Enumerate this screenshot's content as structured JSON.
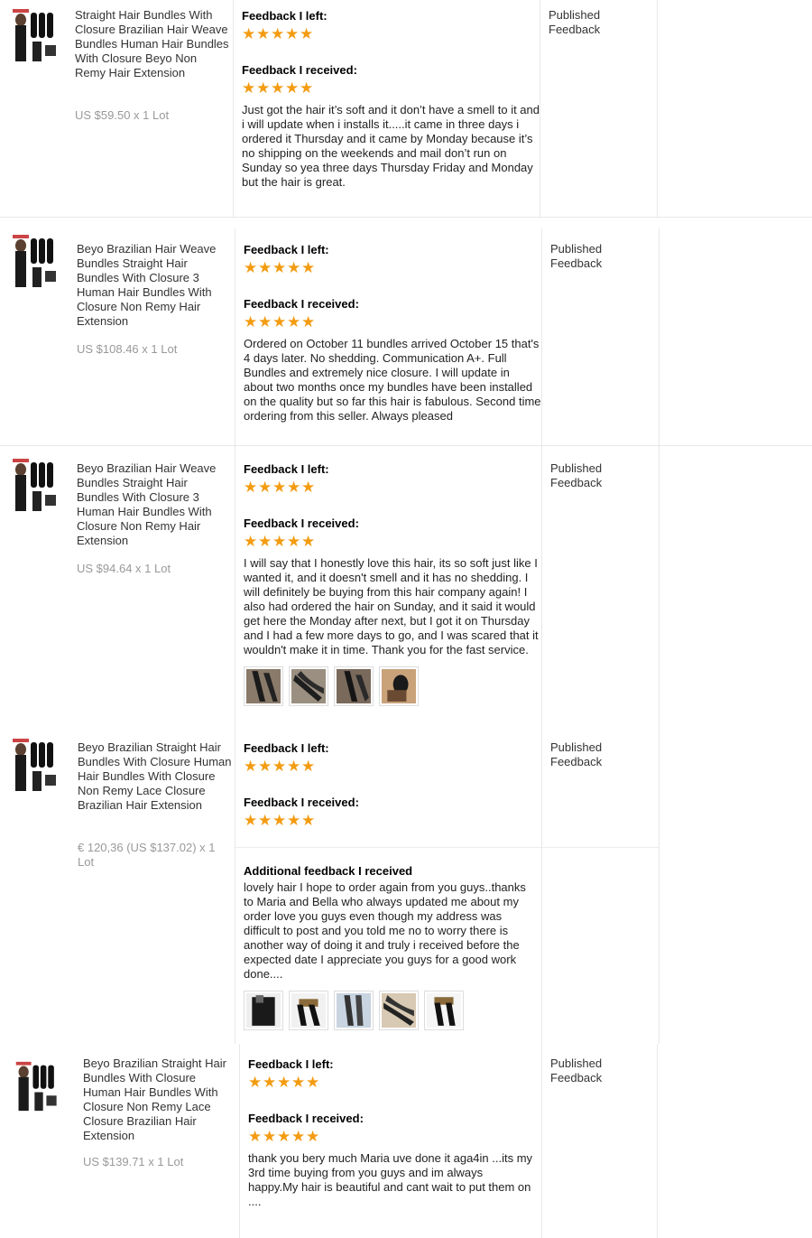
{
  "orders": [
    {
      "title": "Straight Hair Bundles With Closure Brazilian Hair Weave Bundles Human Hair Bundles With Closure Beyo Non Remy Hair Extension",
      "price": "US $59.50 x 1 Lot",
      "left_heading": "Feedback I left:",
      "received_heading": "Feedback I received:",
      "received_text": "Just got the hair it’s soft and it don’t have a smell to it and i will update when i installs it.....it came in three days i ordered it Thursday and it came by Monday because it’s no shipping on the weekends and mail don’t run on Sunday so yea three days Thursday Friday and Monday but the hair is great.",
      "status": "Published Feedback",
      "left_stars": 5,
      "received_stars": 5
    },
    {
      "title": "Beyo Brazilian Hair Weave Bundles Straight Hair Bundles With Closure 3 Human Hair Bundles With Closure Non Remy Hair Extension",
      "price": "US $108.46 x 1 Lot",
      "left_heading": "Feedback I left:",
      "received_heading": "Feedback I received:",
      "received_text": "Ordered on October 11 bundles arrived October 15 that's 4 days later. No shedding. Communication A+. Full Bundles and extremely nice closure. I will update in about two months once my bundles have been installed on the quality but so far this hair is fabulous. Second time ordering from this seller. Always pleased",
      "status": "Published Feedback",
      "left_stars": 5,
      "received_stars": 5
    },
    {
      "title": "Beyo Brazilian Hair Weave Bundles Straight Hair Bundles With Closure 3 Human Hair Bundles With Closure Non Remy Hair Extension",
      "price": "US $94.64 x 1 Lot",
      "left_heading": "Feedback I left:",
      "received_heading": "Feedback I received:",
      "received_text": "I will say that I honestly love this hair, its so soft just like I wanted it, and it doesn't smell and it has no shedding. I will definitely be buying from this hair company again! I also had ordered the hair on Sunday, and it said it would get here the Monday after next, but I got it on Thursday and I had a few more days to go, and I was scared that it wouldn't make it in time. Thank you for the fast service.",
      "status": "Published Feedback",
      "left_stars": 5,
      "received_stars": 5,
      "photo_count": 4
    },
    {
      "title": "Beyo Brazilian Straight Hair Bundles With Closure Human Hair Bundles With Closure Non Remy Lace Closure Brazilian Hair Extension",
      "price": "€ 120,36 (US $137.02) x 1 Lot",
      "left_heading": "Feedback I left:",
      "received_heading": "Feedback I received:",
      "additional_heading": "Additional feedback I received",
      "additional_text": "lovely hair I hope to order again from you guys..thanks to Maria and Bella who always updated me about my order love you guys even though my address was difficult to post and you told me no to worry there is another way of doing it and truly i received before the expected date I appreciate you guys for a good work done....",
      "status": "Published Feedback",
      "left_stars": 5,
      "received_stars": 5,
      "photo_count": 5
    },
    {
      "title": "Beyo Brazilian Straight Hair Bundles With Closure Human Hair Bundles With Closure Non Remy Lace Closure Brazilian Hair Extension",
      "price": "US $139.71 x 1 Lot",
      "left_heading": "Feedback I left:",
      "received_heading": "Feedback I received:",
      "received_text": "thank you bery much Maria uve done it aga4in ...its my 3rd time buying from you guys and im always happy.My hair is beautiful and cant wait to put them on ....",
      "status": "Published Feedback",
      "left_stars": 5,
      "received_stars": 5
    }
  ],
  "colors": {
    "star": "#f39c12",
    "price": "#999999",
    "divider": "#e8e8e8"
  },
  "icons": {
    "star": "star-icon",
    "product": "product-thumbnail",
    "photo": "photo-thumbnail"
  }
}
